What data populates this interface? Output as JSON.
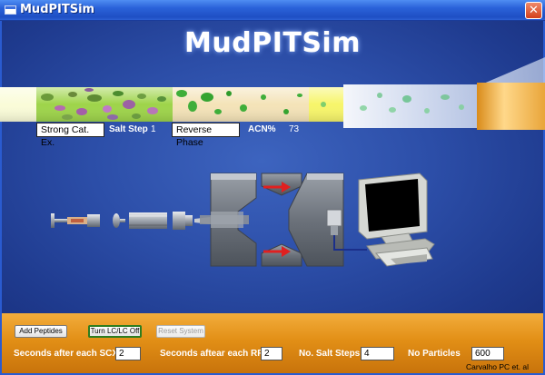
{
  "window": {
    "title": "MudPITSim",
    "close_glyph": "✕"
  },
  "stage": {
    "logo_text": "MudPITSim",
    "scx_label": "Strong Cat. Ex.",
    "salt_step_label": "Salt Step",
    "salt_step_value": "1",
    "rp_label": "Reverse Phase",
    "acn_label": "ACN%",
    "acn_value": "73"
  },
  "controls": {
    "add_peptides_label": "Add Peptides",
    "turn_lclc_label": "Turn LC/LC Off",
    "reset_system_label": "Reset System",
    "scx_seconds_label": "Seconds after each SCX",
    "scx_seconds_value": "2",
    "rp_seconds_label": "Seconds aftear each RP",
    "rp_seconds_value": "2",
    "salt_steps_label": "No. Salt Steps",
    "salt_steps_value": "4",
    "particles_label": "No Particles",
    "particles_value": "600",
    "credit": "Carvalho PC et. al"
  },
  "colors": {
    "background_blue": "#2c4ea8",
    "scx_green": "#9ed44a",
    "rp_tan": "#f4e3b8",
    "particle_green": "#3fae3a",
    "panel_orange": "#e28f16",
    "arrow_red": "#e02020"
  },
  "icons": {
    "window": "window-icon",
    "close": "close-icon",
    "computer": "computer-icon",
    "mass_spec": "mass-spectrometer-icon"
  }
}
